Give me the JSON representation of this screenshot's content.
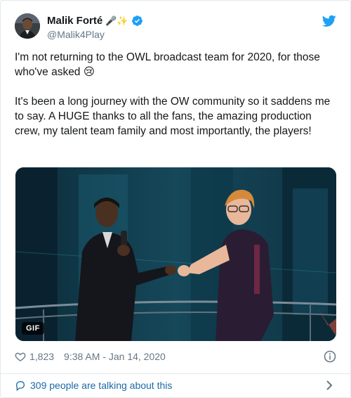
{
  "tweet": {
    "author": {
      "display_name": "Malik Forté",
      "name_emoji": "🎤✨",
      "handle": "@Malik4Play",
      "verified": true
    },
    "paragraphs": [
      "I'm not returning to the OWL broadcast team for 2020, for those who've asked 😢",
      "It's been a long journey with the OW community so it saddens me to say. A HUGE thanks to all the fans, the amazing production crew, my talent team family and most importantly, the players!"
    ],
    "media": {
      "badge": "GIF"
    },
    "likes": "1,823",
    "timestamp": "9:38 AM - Jan 14, 2020",
    "conversation": "309 people are talking about this"
  },
  "icons": {
    "brand": "twitter-bird-icon",
    "verified": "verified-badge-icon",
    "like": "heart-icon",
    "info": "info-icon",
    "reply": "speech-bubble-icon",
    "more": "chevron-right-icon"
  },
  "colors": {
    "twitter_blue": "#1da1f2",
    "link_blue": "#1b6aa5",
    "secondary_text": "#657786",
    "border": "#e1e8ed"
  }
}
